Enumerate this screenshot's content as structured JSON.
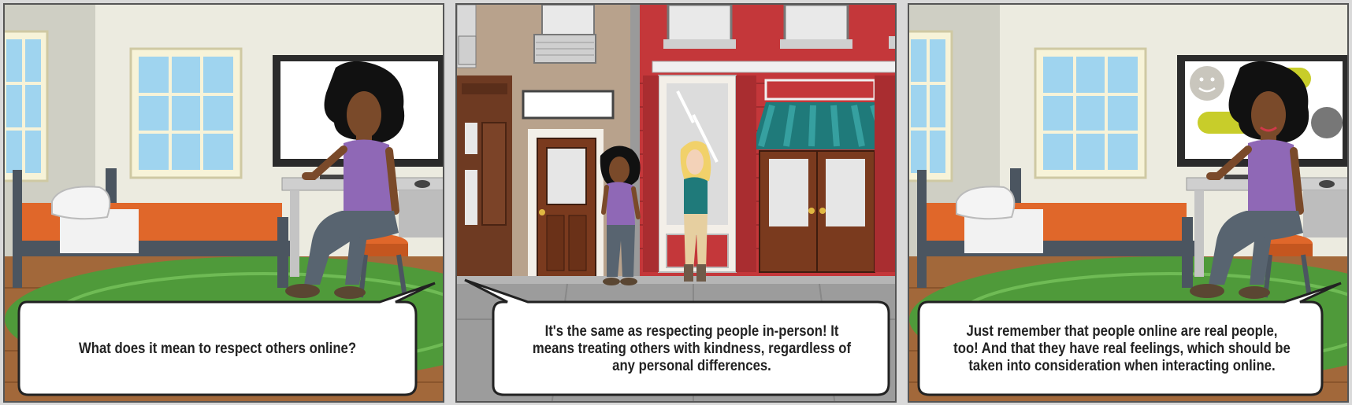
{
  "comic": {
    "panels": [
      {
        "scene": "bedroom",
        "speech": "What does it mean to respect others online?"
      },
      {
        "scene": "street",
        "speech": "It's the same as respecting people in-person! It means treating others with kindness, regardless of any personal differences."
      },
      {
        "scene": "bedroom",
        "speech": "Just remember that people online are real people, too! And that they have real feelings, which should be taken into consideration when interacting online."
      }
    ]
  },
  "colors": {
    "wall": "#ecebe0",
    "bed_sheet": "#e0672a",
    "rug": "#4f9a3a",
    "floor": "#a2683a",
    "brick": "#c4373a",
    "awning": "#1f7a7a",
    "shirt": "#8f68b6"
  }
}
